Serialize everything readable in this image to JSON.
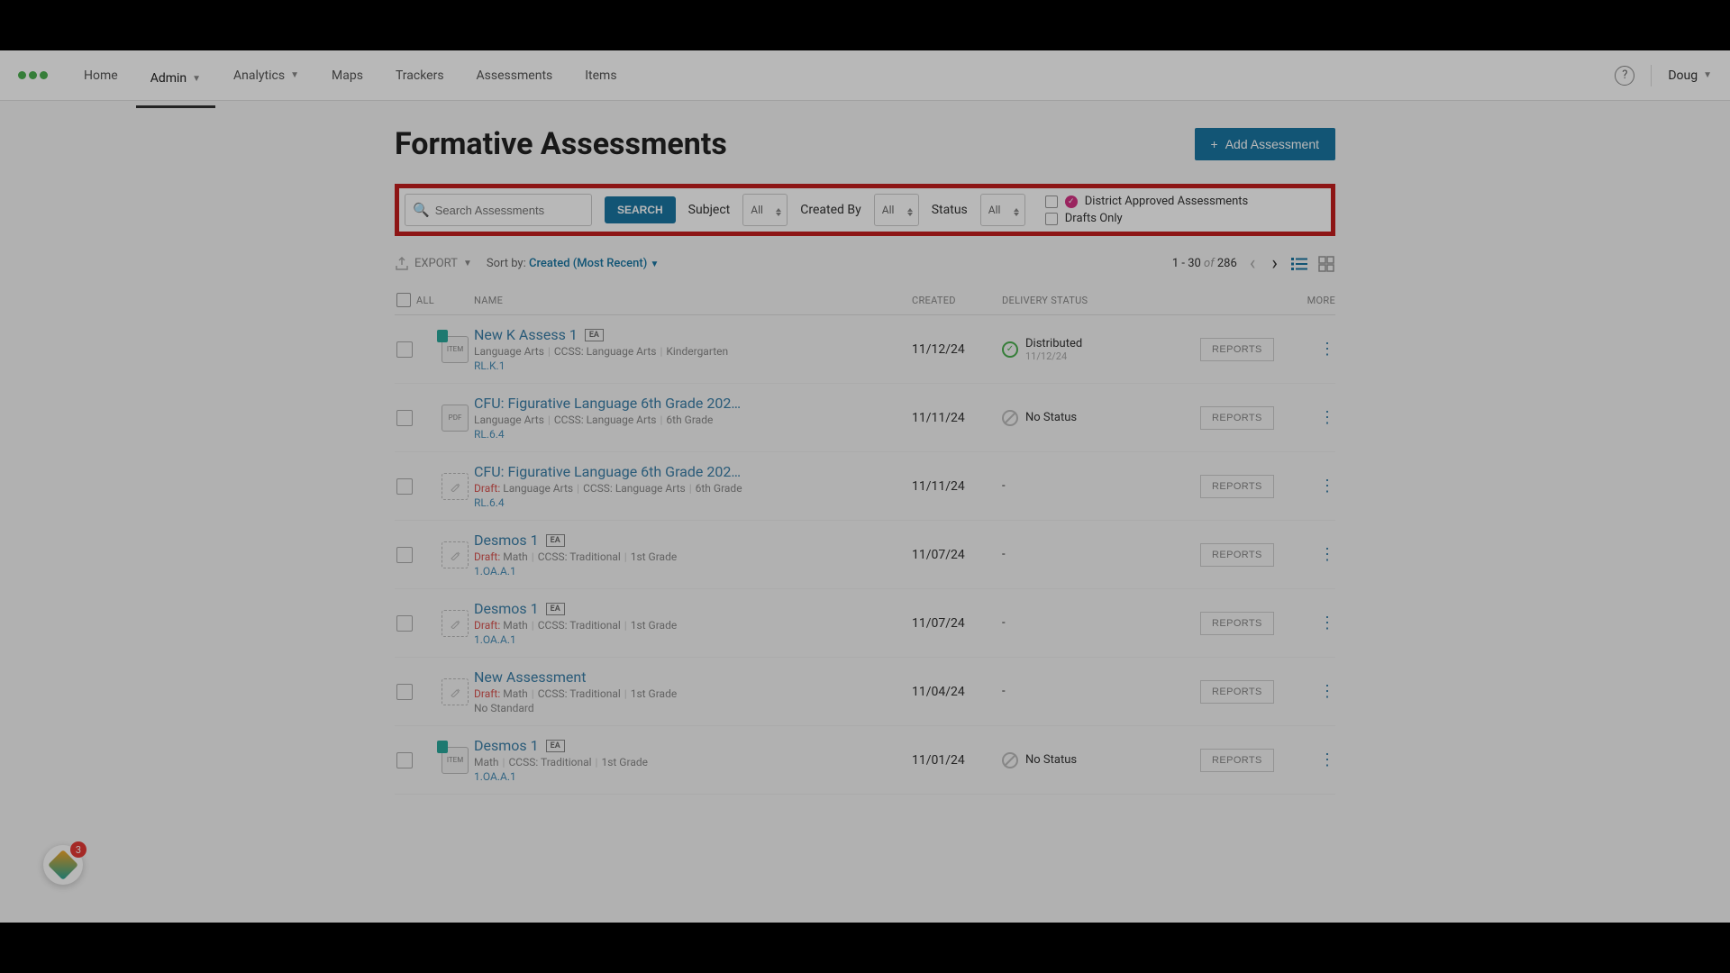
{
  "nav": {
    "items": [
      "Home",
      "Admin",
      "Analytics",
      "Maps",
      "Trackers",
      "Assessments",
      "Items"
    ],
    "active": "Admin",
    "user": "Doug"
  },
  "page": {
    "title": "Formative Assessments",
    "add_label": "Add Assessment"
  },
  "filters": {
    "search_placeholder": "Search Assessments",
    "search_btn": "SEARCH",
    "subject_label": "Subject",
    "subject_value": "All",
    "createdby_label": "Created By",
    "createdby_value": "All",
    "status_label": "Status",
    "status_value": "All",
    "cb_district": "District Approved Assessments",
    "cb_drafts": "Drafts Only"
  },
  "toolbar": {
    "export": "EXPORT",
    "sort_label": "Sort by:",
    "sort_value": "Created (Most Recent)",
    "range": "1 - 30",
    "of": "of",
    "total": "286"
  },
  "columns": {
    "all": "ALL",
    "name": "NAME",
    "created": "CREATED",
    "status": "DELIVERY STATUS",
    "more": "MORE"
  },
  "buttons": {
    "reports": "REPORTS"
  },
  "rows": [
    {
      "title": "New K Assess 1",
      "badge": "EA",
      "draft": false,
      "thumb": "locked-item",
      "meta": [
        "Language Arts",
        "CCSS: Language Arts",
        "Kindergarten"
      ],
      "standard": "RL.K.1",
      "created": "11/12/24",
      "status": "Distributed",
      "status_sub": "11/12/24",
      "status_icon": "dist"
    },
    {
      "title": "CFU: Figurative Language 6th Grade 202…",
      "badge": "",
      "draft": false,
      "thumb": "pdf",
      "meta": [
        "Language Arts",
        "CCSS: Language Arts",
        "6th Grade"
      ],
      "standard": "RL.6.4",
      "created": "11/11/24",
      "status": "No Status",
      "status_sub": "",
      "status_icon": "none"
    },
    {
      "title": "CFU: Figurative Language 6th Grade 202…",
      "badge": "",
      "draft": true,
      "thumb": "draft",
      "meta": [
        "Language Arts",
        "CCSS: Language Arts",
        "6th Grade"
      ],
      "standard": "RL.6.4",
      "created": "11/11/24",
      "status": "-",
      "status_sub": "",
      "status_icon": ""
    },
    {
      "title": "Desmos 1",
      "badge": "EA",
      "draft": true,
      "thumb": "draft",
      "meta": [
        "Math",
        "CCSS: Traditional",
        "1st Grade"
      ],
      "standard": "1.OA.A.1",
      "created": "11/07/24",
      "status": "-",
      "status_sub": "",
      "status_icon": ""
    },
    {
      "title": "Desmos 1",
      "badge": "EA",
      "draft": true,
      "thumb": "draft",
      "meta": [
        "Math",
        "CCSS: Traditional",
        "1st Grade"
      ],
      "standard": "1.OA.A.1",
      "created": "11/07/24",
      "status": "-",
      "status_sub": "",
      "status_icon": ""
    },
    {
      "title": "New Assessment",
      "badge": "",
      "draft": true,
      "thumb": "draft",
      "meta": [
        "Math",
        "CCSS: Traditional",
        "1st Grade"
      ],
      "standard": "No Standard",
      "created": "11/04/24",
      "status": "-",
      "status_sub": "",
      "status_icon": ""
    },
    {
      "title": "Desmos 1",
      "badge": "EA",
      "draft": false,
      "thumb": "locked-item",
      "meta": [
        "Math",
        "CCSS: Traditional",
        "1st Grade"
      ],
      "standard": "1.OA.A.1",
      "created": "11/01/24",
      "status": "No Status",
      "status_sub": "",
      "status_icon": "none"
    }
  ],
  "labels": {
    "draft": "Draft:",
    "no_std": "No Standard"
  },
  "floating_badge_count": "3"
}
